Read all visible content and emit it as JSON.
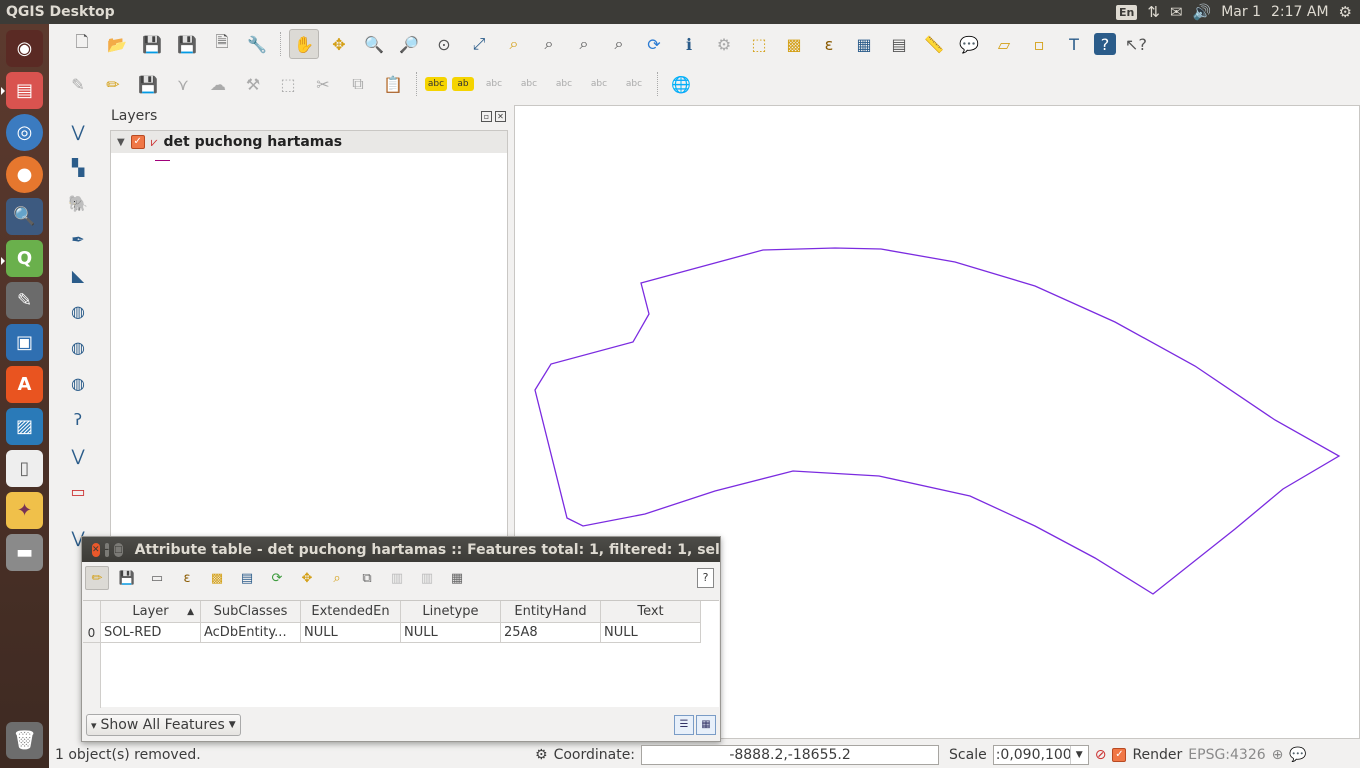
{
  "topbar": {
    "title": "QGIS Desktop",
    "keyboard": "En",
    "date": "Mar 1",
    "time": "2:17 AM"
  },
  "launcher": {
    "items": [
      "ubuntu-dash-icon",
      "files-icon",
      "chromium-icon",
      "firefox-icon",
      "search-icon",
      "qgis-icon",
      "gimp-icon",
      "screenshot-icon",
      "software-center-icon",
      "image-viewer-icon",
      "text-editor-icon",
      "cleaner-icon",
      "disk-icon",
      "trash-icon"
    ]
  },
  "toolbar1": [
    "new",
    "open",
    "save",
    "save-as",
    "new-print-composer",
    "composer-manager",
    "pan",
    "pan-to-selection",
    "zoom-in",
    "zoom-out",
    "zoom-1-1",
    "zoom-full",
    "zoom-to-selection",
    "zoom-to-layer",
    "zoom-last",
    "zoom-next",
    "refresh",
    "identify",
    "action",
    "select",
    "deselect",
    "expression-select",
    "attribute-table",
    "statistics",
    "measure",
    "annotation",
    "new-spatialite",
    "new-temp",
    "text-annotation",
    "help",
    "whats-this"
  ],
  "layers_panel": {
    "title": "Layers",
    "layer_name": "det puchong hartamas"
  },
  "attribute_table": {
    "title": "Attribute table - det puchong hartamas :: Features total: 1, filtered: 1, selec",
    "help": "?",
    "columns": [
      "Layer",
      "SubClasses",
      "ExtendedEn",
      "Linetype",
      "EntityHand",
      "Text"
    ],
    "rows": [
      {
        "num": "0",
        "cells": [
          "SOL-RED",
          "AcDbEntity...",
          "NULL",
          "NULL",
          "25A8",
          "NULL"
        ]
      }
    ],
    "filter_button": "Show All Features"
  },
  "map": {
    "line_color": "#7b2be0"
  },
  "status": {
    "message": "1 object(s) removed.",
    "coordinate_label": "Coordinate:",
    "coordinate_value": "-8888.2,-18655.2",
    "scale_label": "Scale",
    "scale_value": ":0,090,100",
    "render_label": "Render",
    "crs": "EPSG:4326"
  }
}
